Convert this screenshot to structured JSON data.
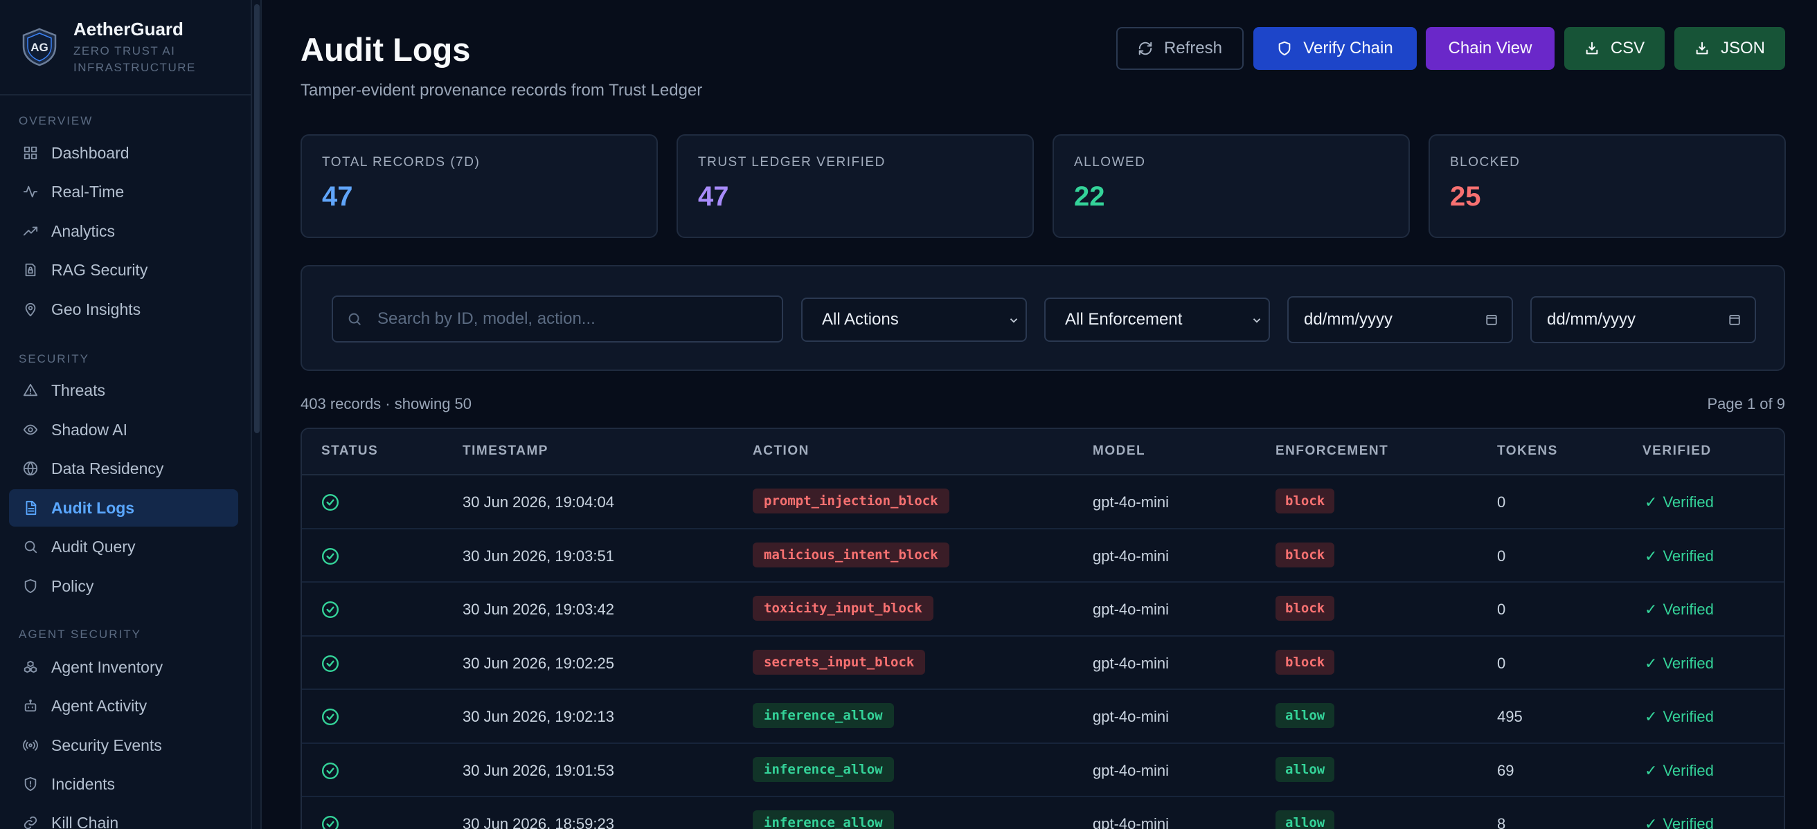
{
  "brand": {
    "name": "AetherGuard",
    "sub1": "ZERO TRUST AI",
    "sub2": "INFRASTRUCTURE",
    "logo_text": "AG"
  },
  "sidebar": {
    "sections": [
      {
        "label": "OVERVIEW"
      },
      {
        "label": "SECURITY"
      },
      {
        "label": "AGENT SECURITY"
      }
    ],
    "items": [
      {
        "label": "Dashboard",
        "icon": "grid-icon"
      },
      {
        "label": "Real-Time",
        "icon": "activity-icon"
      },
      {
        "label": "Analytics",
        "icon": "trending-icon"
      },
      {
        "label": "RAG Security",
        "icon": "database-lock-icon"
      },
      {
        "label": "Geo Insights",
        "icon": "map-pin-icon"
      },
      {
        "label": "Threats",
        "icon": "warning-icon"
      },
      {
        "label": "Shadow AI",
        "icon": "eye-icon"
      },
      {
        "label": "Data Residency",
        "icon": "globe-icon"
      },
      {
        "label": "Audit Logs",
        "icon": "file-text-icon",
        "active": true
      },
      {
        "label": "Audit Query",
        "icon": "search-icon"
      },
      {
        "label": "Policy",
        "icon": "shield-icon"
      },
      {
        "label": "Agent Inventory",
        "icon": "boxes-icon"
      },
      {
        "label": "Agent Activity",
        "icon": "bot-icon"
      },
      {
        "label": "Security Events",
        "icon": "radio-icon"
      },
      {
        "label": "Incidents",
        "icon": "shield-alert-icon"
      },
      {
        "label": "Kill Chain",
        "icon": "link-icon"
      }
    ]
  },
  "header": {
    "title": "Audit Logs",
    "subtitle": "Tamper-evident provenance records from Trust Ledger"
  },
  "toolbar": {
    "refresh_label": "Refresh",
    "verify_label": "Verify Chain",
    "chain_label": "Chain View",
    "csv_label": "CSV",
    "json_label": "JSON"
  },
  "stats": [
    {
      "label": "TOTAL RECORDS (7D)",
      "value": "47",
      "color": "#60a5fa"
    },
    {
      "label": "TRUST LEDGER VERIFIED",
      "value": "47",
      "color": "#a78bfa"
    },
    {
      "label": "ALLOWED",
      "value": "22",
      "color": "#34d399"
    },
    {
      "label": "BLOCKED",
      "value": "25",
      "color": "#f87171"
    }
  ],
  "filters": {
    "search_placeholder": "Search by ID, model, action...",
    "action_select": "All Actions",
    "enforcement_select": "All Enforcement",
    "date_from": "dd/mm/yyyy",
    "date_to": "dd/mm/yyyy"
  },
  "records": {
    "summary": "403 records · showing 50",
    "page": "Page 1 of 9"
  },
  "table": {
    "columns": [
      "STATUS",
      "TIMESTAMP",
      "ACTION",
      "MODEL",
      "ENFORCEMENT",
      "TOKENS",
      "VERIFIED"
    ],
    "rows": [
      {
        "timestamp": "30 Jun 2026, 19:04:04",
        "action": "prompt_injection_block",
        "model": "gpt-4o-mini",
        "enforcement": "block",
        "tokens": "0",
        "verified": "Verified"
      },
      {
        "timestamp": "30 Jun 2026, 19:03:51",
        "action": "malicious_intent_block",
        "model": "gpt-4o-mini",
        "enforcement": "block",
        "tokens": "0",
        "verified": "Verified"
      },
      {
        "timestamp": "30 Jun 2026, 19:03:42",
        "action": "toxicity_input_block",
        "model": "gpt-4o-mini",
        "enforcement": "block",
        "tokens": "0",
        "verified": "Verified"
      },
      {
        "timestamp": "30 Jun 2026, 19:02:25",
        "action": "secrets_input_block",
        "model": "gpt-4o-mini",
        "enforcement": "block",
        "tokens": "0",
        "verified": "Verified"
      },
      {
        "timestamp": "30 Jun 2026, 19:02:13",
        "action": "inference_allow",
        "model": "gpt-4o-mini",
        "enforcement": "allow",
        "tokens": "495",
        "verified": "Verified"
      },
      {
        "timestamp": "30 Jun 2026, 19:01:53",
        "action": "inference_allow",
        "model": "gpt-4o-mini",
        "enforcement": "allow",
        "tokens": "69",
        "verified": "Verified"
      },
      {
        "timestamp": "30 Jun 2026, 18:59:23",
        "action": "inference_allow",
        "model": "gpt-4o-mini",
        "enforcement": "allow",
        "tokens": "8",
        "verified": "Verified"
      }
    ]
  }
}
